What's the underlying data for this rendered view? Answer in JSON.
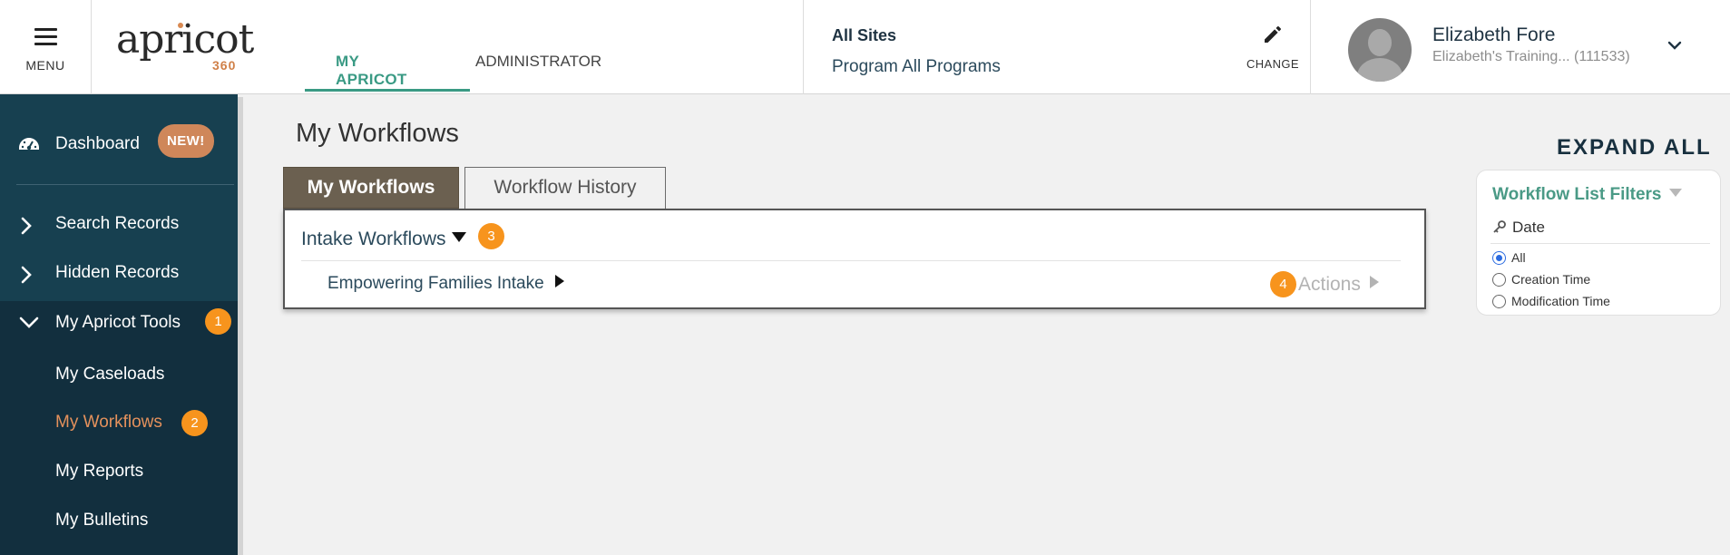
{
  "header": {
    "menu_label": "MENU",
    "logo_word": "apricot",
    "logo_number": "360",
    "tabs": [
      {
        "label": "MY APRICOT",
        "active": true
      },
      {
        "label": "ADMINISTRATOR",
        "active": false
      }
    ],
    "sites": {
      "title": "All Sites",
      "program": "Program All Programs",
      "change_label": "CHANGE"
    },
    "user": {
      "name": "Elizabeth Fore",
      "org": "Elizabeth's Training...",
      "org_id": "(111533)"
    }
  },
  "sidebar": {
    "dashboard": {
      "label": "Dashboard",
      "badge": "NEW!"
    },
    "items": [
      {
        "label": "Search Records"
      },
      {
        "label": "Hidden Records"
      },
      {
        "label": "My Apricot Tools",
        "badge": "1"
      }
    ],
    "subitems": [
      {
        "label": "My Caseloads"
      },
      {
        "label": "My Workflows",
        "badge": "2",
        "active": true
      },
      {
        "label": "My Reports"
      },
      {
        "label": "My Bulletins"
      }
    ]
  },
  "main": {
    "title": "My Workflows",
    "tabs": [
      {
        "label": "My Workflows",
        "active": true
      },
      {
        "label": "Workflow History",
        "active": false
      }
    ],
    "group": {
      "label": "Intake Workflows",
      "badge": "3"
    },
    "workflows": [
      {
        "label": "Empowering Families Intake",
        "badge": "4",
        "actions": "Actions"
      }
    ],
    "expand_all": "EXPAND ALL"
  },
  "filters": {
    "title": "Workflow List Filters",
    "date_label": "Date",
    "options": [
      {
        "label": "All",
        "checked": true
      },
      {
        "label": "Creation Time",
        "checked": false
      },
      {
        "label": "Modification Time",
        "checked": false
      }
    ]
  },
  "colors": {
    "brand_green": "#3a9a84",
    "sidebar_dark": "#122f3e",
    "badge_orange": "#f7941d",
    "new_badge": "#cf875a",
    "active_link": "#e4915c"
  }
}
